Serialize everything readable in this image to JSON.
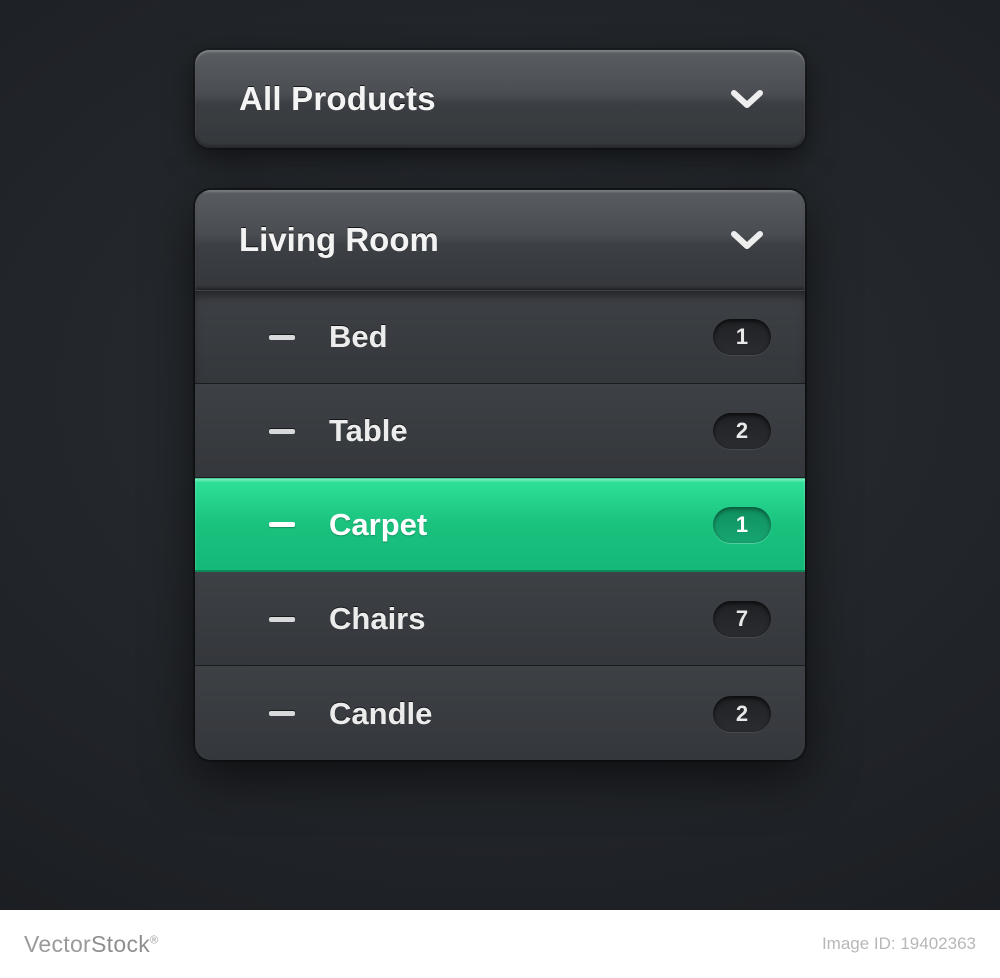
{
  "topDropdown": {
    "label": "All Products"
  },
  "panel": {
    "header": {
      "label": "Living Room"
    },
    "items": [
      {
        "label": "Bed",
        "count": "1",
        "active": false
      },
      {
        "label": "Table",
        "count": "2",
        "active": false
      },
      {
        "label": "Carpet",
        "count": "1",
        "active": true
      },
      {
        "label": "Chairs",
        "count": "7",
        "active": false
      },
      {
        "label": "Candle",
        "count": "2",
        "active": false
      }
    ]
  },
  "footer": {
    "brandPrefix": "Vector",
    "brandSuffix": "Stock",
    "idText": "Image ID: 19402363"
  },
  "colors": {
    "accent": "#1ac27e"
  }
}
